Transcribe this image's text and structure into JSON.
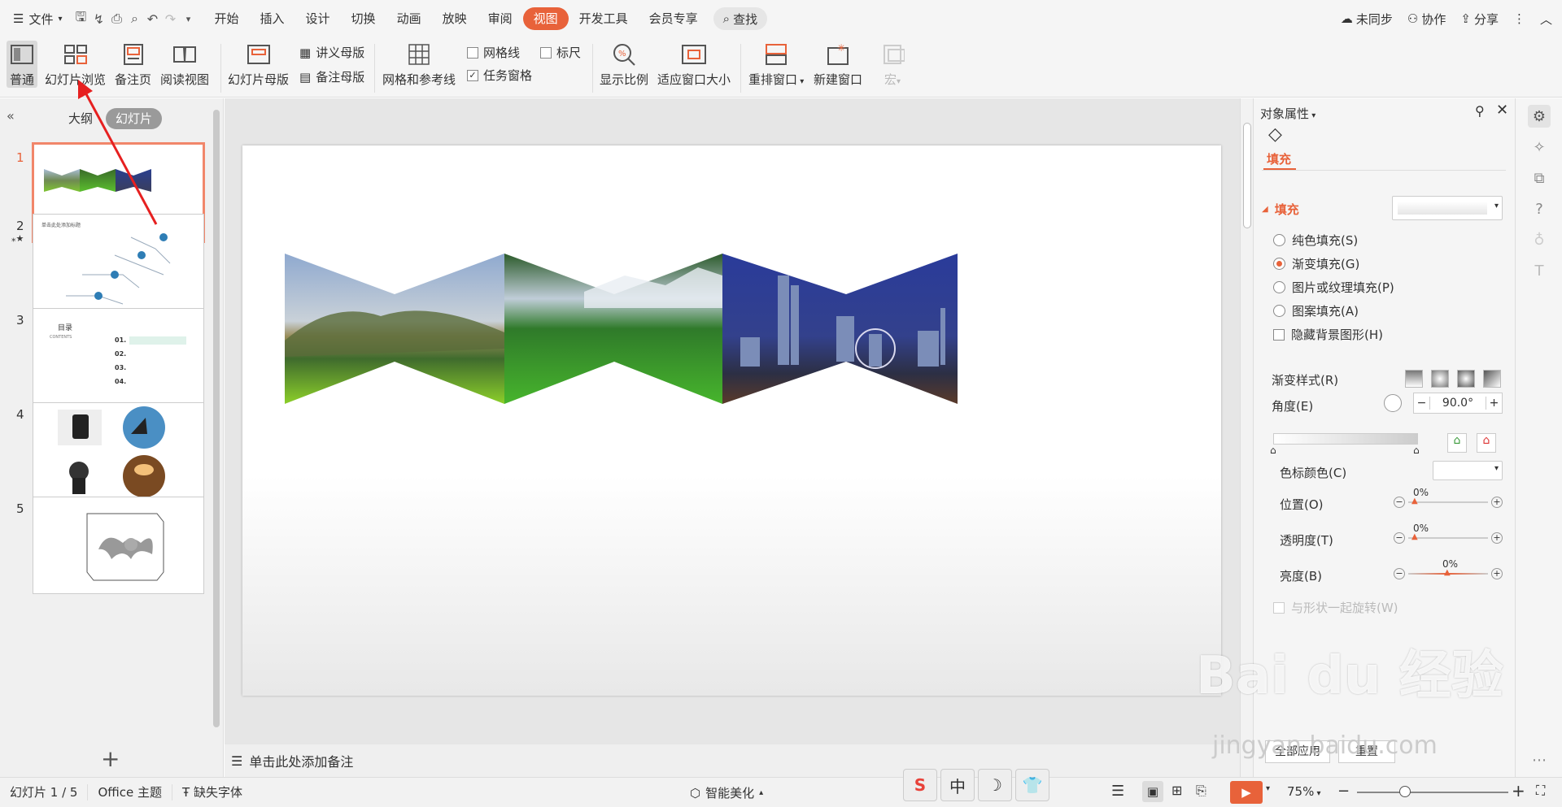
{
  "window": {
    "file_menu": "文件",
    "tabs": [
      "开始",
      "插入",
      "设计",
      "切换",
      "动画",
      "放映",
      "审阅",
      "视图",
      "开发工具",
      "会员专享"
    ],
    "active_tab": "视图",
    "search_label": "查找",
    "right_actions": [
      "未同步",
      "协作",
      "分享"
    ]
  },
  "ribbon": {
    "normal": "普通",
    "slide_sorter": "幻灯片浏览",
    "notes_page": "备注页",
    "reading_view": "阅读视图",
    "slide_master": "幻灯片母版",
    "handout_master": "讲义母版",
    "notes_master": "备注母版",
    "grid_guides": "网格和参考线",
    "gridlines": "网格线",
    "ruler": "标尺",
    "task_pane": "任务窗格",
    "zoom": "显示比例",
    "fit_window": "适应窗口大小",
    "arrange_window": "重排窗口",
    "new_window": "新建窗口",
    "macro": "宏"
  },
  "left_pane": {
    "tab_outline": "大纲",
    "tab_slides": "幻灯片",
    "slide_numbers": [
      "1",
      "2",
      "3",
      "4",
      "5"
    ],
    "thumb2_title": "单击此处添加标题",
    "thumb3_title": "目录",
    "thumb3_subtitle": "CONTENTS",
    "thumb3_items": [
      "01.",
      "02.",
      "03.",
      "04."
    ],
    "add_slide": "+"
  },
  "notes_placeholder": "单击此处添加备注",
  "props": {
    "title": "对象属性",
    "tab_fill": "填充",
    "section_fill": "填充",
    "opt_solid": "纯色填充(S)",
    "opt_gradient": "渐变填充(G)",
    "opt_picture": "图片或纹理填充(P)",
    "opt_pattern": "图案填充(A)",
    "opt_hide_bg": "隐藏背景图形(H)",
    "gradient_style": "渐变样式(R)",
    "angle": "角度(E)",
    "angle_value": "90.0°",
    "stop_color": "色标颜色(C)",
    "position": "位置(O)",
    "position_value": "0%",
    "transparency": "透明度(T)",
    "transparency_value": "0%",
    "brightness": "亮度(B)",
    "brightness_value": "0%",
    "rotate_with_shape": "与形状一起旋转(W)",
    "apply_all": "全部应用",
    "reset": "重置"
  },
  "status": {
    "slide_counter": "幻灯片 1 / 5",
    "theme": "Office 主题",
    "missing_fonts": "缺失字体",
    "smart_beautify": "智能美化",
    "zoom": "75%"
  },
  "ime_keys": [
    "S",
    "中",
    "☽",
    "👕"
  ],
  "watermark": {
    "logo": "Bai du 经验",
    "url": "jingyan.baidu.com"
  },
  "colors": {
    "accent": "#e8623a",
    "selection": "#f1866a"
  }
}
